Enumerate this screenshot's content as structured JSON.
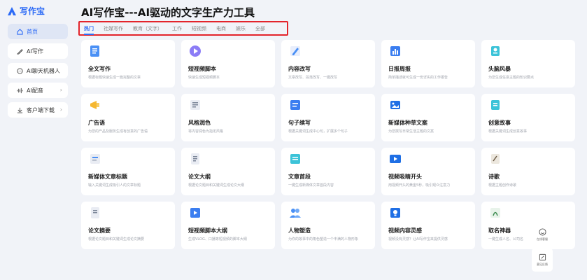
{
  "app": {
    "logo_text": "写作宝",
    "page_title": "AI写作宝---AI驱动的文字生产力工具"
  },
  "sidebar": {
    "items": [
      {
        "label": "首页",
        "icon": "home-icon"
      },
      {
        "label": "AI写作",
        "icon": "pen-icon"
      },
      {
        "label": "AI聊天机器人",
        "icon": "chat-bubble-icon"
      },
      {
        "label": "AI配音",
        "icon": "audio-wave-icon"
      },
      {
        "label": "客户端下载",
        "icon": "download-icon"
      }
    ],
    "arrow": "›"
  },
  "tabs": [
    "热门",
    "社媒写作",
    "教育（文字）",
    "工作",
    "短视频",
    "电商",
    "娱乐",
    "全部"
  ],
  "cards": [
    {
      "title": "全文写作",
      "desc": "根据标题快速生成一篇完整的文章",
      "icon": "document-icon"
    },
    {
      "title": "短视频脚本",
      "desc": "快速生成短视频脚本",
      "icon": "video-play-icon"
    },
    {
      "title": "内容改写",
      "desc": "文章改写、段落改写、一键改写",
      "icon": "rewrite-icon"
    },
    {
      "title": "日报周报",
      "desc": "简单描述就可生成一份详实的工作报告",
      "icon": "report-icon"
    },
    {
      "title": "头脑风暴",
      "desc": "为您生成任意主题的知识要点",
      "icon": "brainstorm-icon"
    },
    {
      "title": "广告语",
      "desc": "为您的产品及服务生成有创意的广告语",
      "icon": "megaphone-icon"
    },
    {
      "title": "风格润色",
      "desc": "将内容润色为指定风格",
      "icon": "style-polish-icon"
    },
    {
      "title": "句子续写",
      "desc": "根据关键词生成中心句，扩展多个句子",
      "icon": "sentence-icon"
    },
    {
      "title": "新媒体种草文案",
      "desc": "为您撰写日常生活主题的文案",
      "icon": "new-media-icon"
    },
    {
      "title": "创意故事",
      "desc": "根据关键词生成创意故事",
      "icon": "story-icon"
    },
    {
      "title": "新媒体文章标题",
      "desc": "输入关键词生成吸引人的文章标题",
      "icon": "headline-icon"
    },
    {
      "title": "论文大纲",
      "desc": "根据论文题目和关键词生成论文大纲",
      "icon": "outline-icon"
    },
    {
      "title": "文章首段",
      "desc": "一键生成新媒体文章首段内容",
      "icon": "paragraph-icon"
    },
    {
      "title": "视频吸睛开头",
      "desc": "用视频开头的黄金5秒，吸引观众注意力",
      "icon": "video-opening-icon"
    },
    {
      "title": "诗歌",
      "desc": "根据主题创作诗歌",
      "icon": "poem-icon"
    },
    {
      "title": "论文摘要",
      "desc": "根据论文题目和关键词生成论文摘要",
      "icon": "abstract-icon"
    },
    {
      "title": "短视频脚本大纲",
      "desc": "生成VLOG、口播等短视频的脚本大纲",
      "icon": "script-outline-icon"
    },
    {
      "title": "人物塑造",
      "desc": "为你的故事中的角色塑造一个丰满的人物形象",
      "icon": "people-icon"
    },
    {
      "title": "视频内容灵感",
      "desc": "视频没有灵感？让AI写作宝来提供灵感",
      "icon": "inspiration-icon"
    },
    {
      "title": "取名神器",
      "desc": "一键生成人名、公司名",
      "icon": "naming-icon"
    }
  ],
  "float": {
    "service_label": "在线客服",
    "feedback_label": "意见反馈"
  },
  "colors": {
    "accent": "#2d6bf6",
    "highlight_border": "#e3242b",
    "background": "#f1f3f8"
  }
}
